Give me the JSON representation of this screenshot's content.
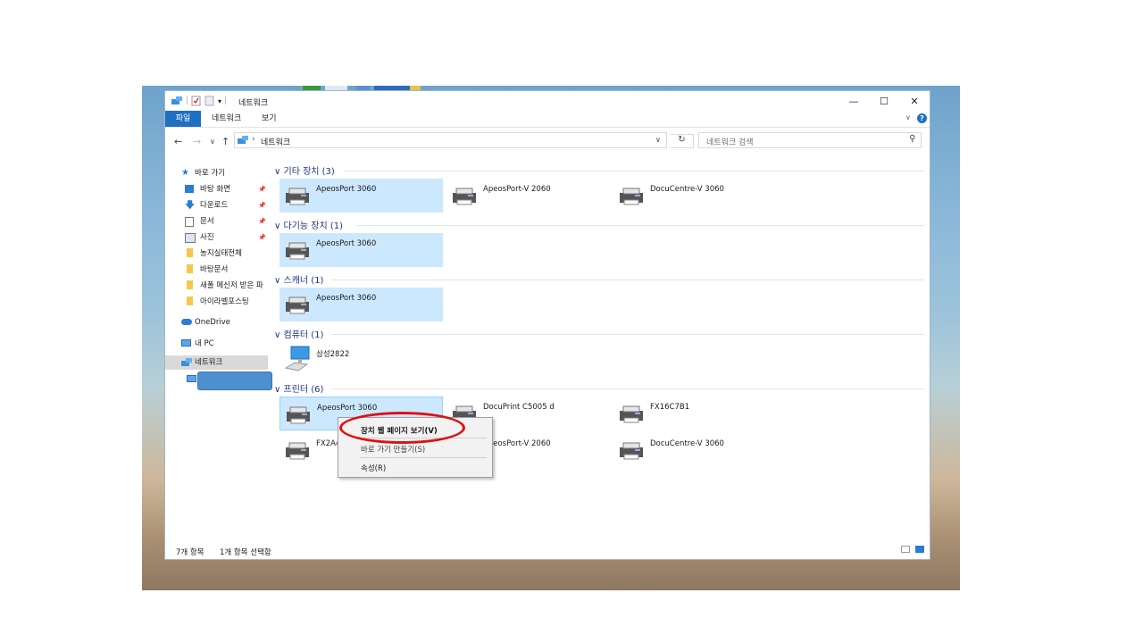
{
  "window": {
    "title": "네트워크",
    "controls": {
      "minimize": "—",
      "maximize": "☐",
      "close": "✕"
    }
  },
  "ribbon": {
    "tabs": [
      "파일",
      "네트워크",
      "보기"
    ],
    "expand": "∨",
    "help": "?"
  },
  "address": {
    "path": "네트워크",
    "search_placeholder": "네트워크 검색",
    "nav": {
      "back": "←",
      "forward": "→",
      "recent": "∨",
      "up": "↑",
      "refresh": "↻",
      "dropdown": "∨",
      "search_icon": "⚲"
    }
  },
  "sidebar": {
    "items": [
      {
        "label": "바로 가기",
        "icon": "star-icon",
        "pinned": false
      },
      {
        "label": "바탕 화면",
        "icon": "desktop-icon",
        "pinned": true
      },
      {
        "label": "다운로드",
        "icon": "download-icon",
        "pinned": true
      },
      {
        "label": "문서",
        "icon": "document-icon",
        "pinned": true
      },
      {
        "label": "사진",
        "icon": "picture-icon",
        "pinned": true
      },
      {
        "label": "농지실태전체",
        "icon": "folder-icon",
        "pinned": false
      },
      {
        "label": "바탕문서",
        "icon": "folder-icon",
        "pinned": false
      },
      {
        "label": "새폴 메신저 받은 파",
        "icon": "folder-icon",
        "pinned": false
      },
      {
        "label": "아이라벨포스팅",
        "icon": "folder-icon",
        "pinned": false
      },
      {
        "label": "OneDrive",
        "icon": "cloud-icon",
        "pinned": false
      },
      {
        "label": "내 PC",
        "icon": "pc-icon",
        "pinned": false
      },
      {
        "label": "네트워크",
        "icon": "network-icon",
        "pinned": false
      }
    ],
    "pin_glyph": "📌"
  },
  "groups": [
    {
      "label": "기타 장치 (3)",
      "items": [
        "ApeosPort 3060",
        "ApeosPort-V 2060",
        "DocuCentre-V 3060"
      ]
    },
    {
      "label": "다기능 장치 (1)",
      "items": [
        "ApeosPort 3060"
      ]
    },
    {
      "label": "스캐너 (1)",
      "items": [
        "ApeosPort 3060"
      ]
    },
    {
      "label": "컴퓨터 (1)",
      "items": [
        "삼성2822"
      ]
    },
    {
      "label": "프린터 (6)",
      "items": [
        "ApeosPort 3060",
        "DocuPrint C5005 d",
        "FX16C7B1",
        "FX2A4",
        "ApeosPort-V 2060",
        "DocuCentre-V 3060"
      ]
    }
  ],
  "context_menu": {
    "items": [
      "장치 웹 페이지 보기(V)",
      "바로 가기 만들기(S)",
      "속성(R)"
    ]
  },
  "status": {
    "count": "7개 항목",
    "selected": "1개 항목 선택함"
  },
  "colors": {
    "accent": "#1f6fc3",
    "selection": "#cce8ff",
    "group_label": "#1e3287",
    "highlight_circle": "#e01010"
  }
}
